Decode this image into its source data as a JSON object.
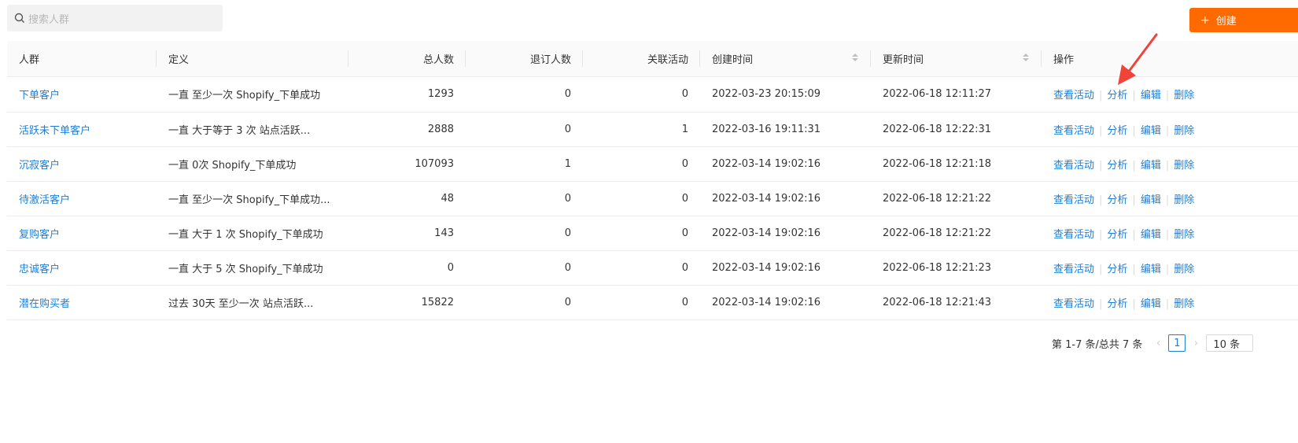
{
  "search": {
    "placeholder": "搜索人群"
  },
  "create_button": {
    "label": "创建"
  },
  "columns": {
    "name": "人群",
    "definition": "定义",
    "total": "总人数",
    "unsubscribed": "退订人数",
    "activities": "关联活动",
    "created": "创建时间",
    "updated": "更新时间",
    "actions": "操作"
  },
  "actions": {
    "view": "查看活动",
    "analyze": "分析",
    "edit": "编辑",
    "delete": "删除"
  },
  "rows": [
    {
      "name": "下单客户",
      "definition": "一直 至少一次 Shopify_下单成功",
      "total": "1293",
      "unsubscribed": "0",
      "activities": "0",
      "created": "2022-03-23 20:15:09",
      "updated": "2022-06-18 12:11:27"
    },
    {
      "name": "活跃未下单客户",
      "definition": "一直 大于等于 3 次 站点活跃...",
      "total": "2888",
      "unsubscribed": "0",
      "activities": "1",
      "created": "2022-03-16 19:11:31",
      "updated": "2022-06-18 12:22:31"
    },
    {
      "name": "沉寂客户",
      "definition": "一直 0次 Shopify_下单成功",
      "total": "107093",
      "unsubscribed": "1",
      "activities": "0",
      "created": "2022-03-14 19:02:16",
      "updated": "2022-06-18 12:21:18"
    },
    {
      "name": "待激活客户",
      "definition": "一直 至少一次 Shopify_下单成功...",
      "total": "48",
      "unsubscribed": "0",
      "activities": "0",
      "created": "2022-03-14 19:02:16",
      "updated": "2022-06-18 12:21:22"
    },
    {
      "name": "复购客户",
      "definition": "一直 大于 1 次 Shopify_下单成功",
      "total": "143",
      "unsubscribed": "0",
      "activities": "0",
      "created": "2022-03-14 19:02:16",
      "updated": "2022-06-18 12:21:22"
    },
    {
      "name": "忠诚客户",
      "definition": "一直 大于 5 次 Shopify_下单成功",
      "total": "0",
      "unsubscribed": "0",
      "activities": "0",
      "created": "2022-03-14 19:02:16",
      "updated": "2022-06-18 12:21:23"
    },
    {
      "name": "潜在购买者",
      "definition": "过去 30天 至少一次 站点活跃...",
      "total": "15822",
      "unsubscribed": "0",
      "activities": "0",
      "created": "2022-03-14 19:02:16",
      "updated": "2022-06-18 12:21:43"
    }
  ],
  "pagination": {
    "total_text": "第 1-7 条/总共 7 条",
    "current_page": "1",
    "page_size": "10 条"
  },
  "colors": {
    "accent": "#ff6a00",
    "link": "#1e7fd6",
    "annotation": "#f0443a"
  }
}
